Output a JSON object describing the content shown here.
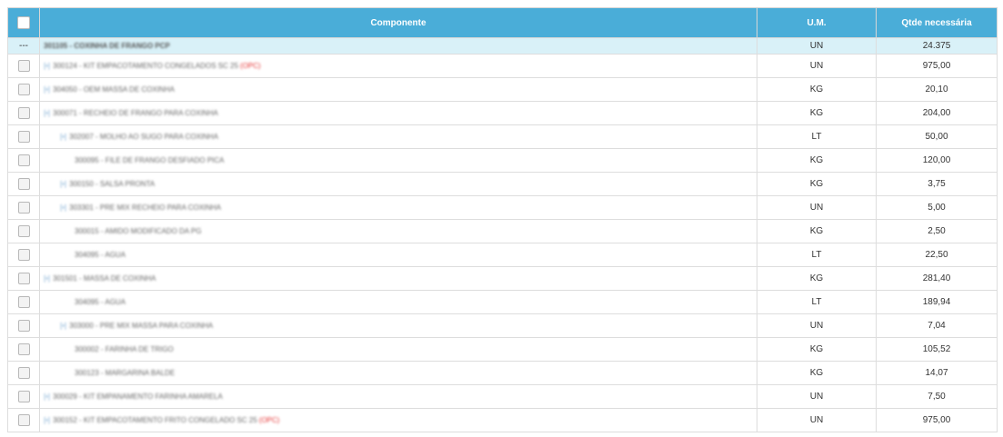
{
  "table": {
    "headers": {
      "select_all": "",
      "component": "Componente",
      "unit": "U.M.",
      "quantity": "Qtde necessária"
    },
    "parent": {
      "marker": "---",
      "name": "301105 - COXINHA DE FRANGO PCP",
      "unit": "UN",
      "quantity": "24.375"
    },
    "rows": [
      {
        "level": 0,
        "toggle": "[+]",
        "name": "300124 - KIT EMPACOTAMENTO CONGELADOS SC 25",
        "tag": "(OPC)",
        "unit": "UN",
        "quantity": "975,00"
      },
      {
        "level": 0,
        "toggle": "[+]",
        "name": "304050 - OEM MASSA DE COXINHA",
        "tag": "",
        "unit": "KG",
        "quantity": "20,10"
      },
      {
        "level": 0,
        "toggle": "[+]",
        "name": "300071 - RECHEIO DE FRANGO PARA COXINHA",
        "tag": "",
        "unit": "KG",
        "quantity": "204,00"
      },
      {
        "level": 1,
        "toggle": "[+]",
        "name": "302007 - MOLHO AO SUGO PARA COXINHA",
        "tag": "",
        "unit": "LT",
        "quantity": "50,00"
      },
      {
        "level": 2,
        "toggle": "",
        "name": "300095 - FILE DE FRANGO DESFIADO PICA",
        "tag": "",
        "unit": "KG",
        "quantity": "120,00"
      },
      {
        "level": 1,
        "toggle": "[+]",
        "name": "300150 - SALSA PRONTA",
        "tag": "",
        "unit": "KG",
        "quantity": "3,75"
      },
      {
        "level": 1,
        "toggle": "[+]",
        "name": "303301 - PRE MIX RECHEIO PARA COXINHA",
        "tag": "",
        "unit": "UN",
        "quantity": "5,00"
      },
      {
        "level": 2,
        "toggle": "",
        "name": "300015 - AMIDO MODIFICADO DA PG",
        "tag": "",
        "unit": "KG",
        "quantity": "2,50"
      },
      {
        "level": 2,
        "toggle": "",
        "name": "304095 - AGUA",
        "tag": "",
        "unit": "LT",
        "quantity": "22,50"
      },
      {
        "level": 0,
        "toggle": "[+]",
        "name": "301501 - MASSA DE COXINHA",
        "tag": "",
        "unit": "KG",
        "quantity": "281,40"
      },
      {
        "level": 2,
        "toggle": "",
        "name": "304095 - AGUA",
        "tag": "",
        "unit": "LT",
        "quantity": "189,94"
      },
      {
        "level": 1,
        "toggle": "[+]",
        "name": "303000 - PRE MIX MASSA PARA COXINHA",
        "tag": "",
        "unit": "UN",
        "quantity": "7,04"
      },
      {
        "level": 2,
        "toggle": "",
        "name": "300002 - FARINHA DE TRIGO",
        "tag": "",
        "unit": "KG",
        "quantity": "105,52"
      },
      {
        "level": 2,
        "toggle": "",
        "name": "300123 - MARGARINA BALDE",
        "tag": "",
        "unit": "KG",
        "quantity": "14,07"
      },
      {
        "level": 0,
        "toggle": "[+]",
        "name": "300029 - KIT EMPANAMENTO FARINHA AMARELA",
        "tag": "",
        "unit": "UN",
        "quantity": "7,50"
      },
      {
        "level": 0,
        "toggle": "[+]",
        "name": "300152 - KIT EMPACOTAMENTO FRITO CONGELADO SC 25",
        "tag": "(OPC)",
        "unit": "UN",
        "quantity": "975,00"
      }
    ]
  },
  "colors": {
    "header_bg": "#4aadd8",
    "parent_bg": "#d9f1f8",
    "tag_red": "#e53333"
  }
}
